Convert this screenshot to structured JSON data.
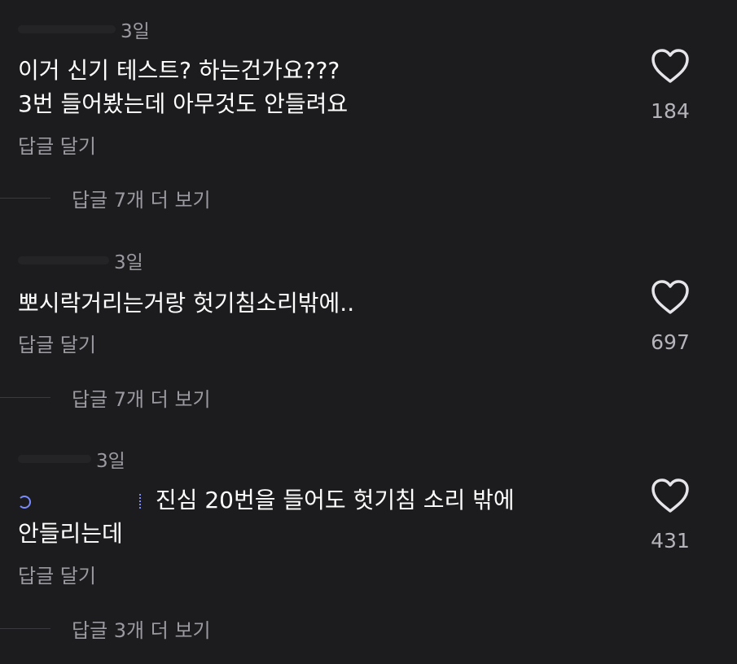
{
  "comments": [
    {
      "time": "3일",
      "line1": "이거 신기 테스트? 하는건가요???",
      "line2": "3번 들어봤는데 아무것도 안들려요",
      "reply": "답글 달기",
      "likes": "184",
      "more": "답글 7개 더 보기"
    },
    {
      "time": "3일",
      "line1": "뽀시락거리는거랑 헛기침소리밖에..",
      "reply": "답글 달기",
      "likes": "697",
      "more": "답글 7개 더 보기"
    },
    {
      "time": "3일",
      "line1": "진심 20번을 들어도 헛기침 소리 밖에",
      "line2": "안들리는데",
      "reply": "답글 달기",
      "likes": "431",
      "more": "답글 3개 더 보기"
    }
  ],
  "icons": {
    "like": "heart-outline-icon",
    "mention": "mention-icon"
  },
  "colors": {
    "background": "#1c1c1f",
    "text": "#ffffff",
    "muted": "#9a9aa0",
    "mention": "#7a8cff"
  }
}
